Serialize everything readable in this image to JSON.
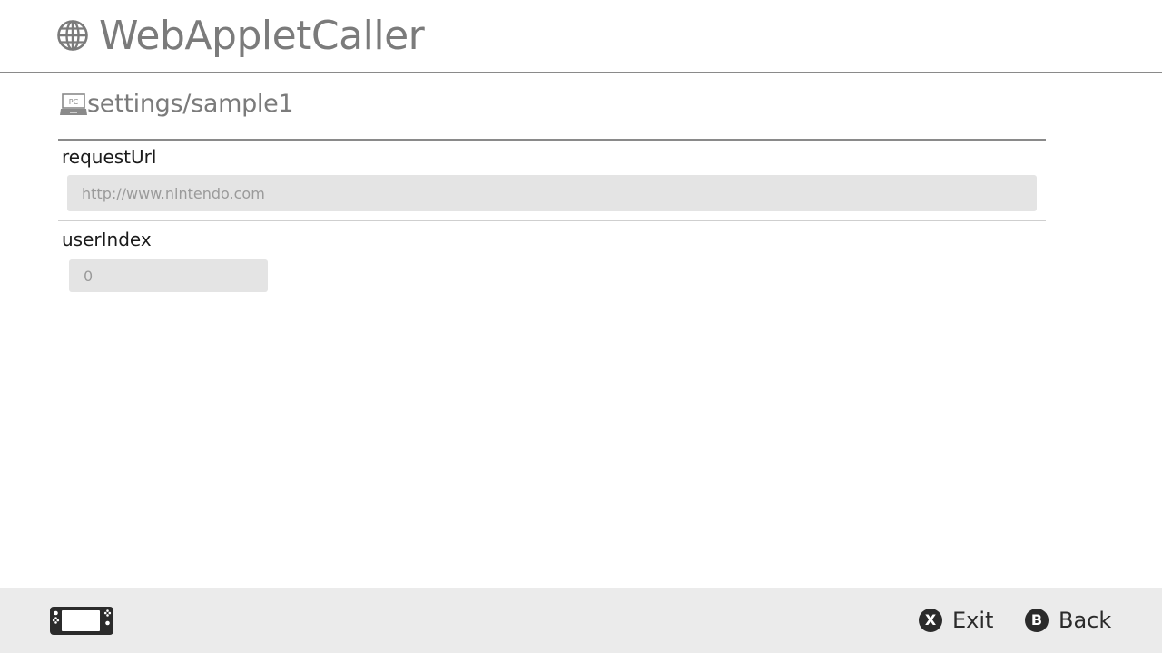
{
  "header": {
    "title": "WebAppletCaller",
    "icon": "globe-icon"
  },
  "section": {
    "title": "settings/sample1",
    "icon": "pc-icon",
    "icon_text": "PC"
  },
  "fields": [
    {
      "label": "requestUrl",
      "value": "",
      "placeholder": "http://www.nintendo.com"
    },
    {
      "label": "userIndex",
      "value": "",
      "placeholder": "0"
    }
  ],
  "footer": {
    "device_icon": "console-handheld-icon",
    "exit": {
      "glyph": "X",
      "label": "Exit"
    },
    "back": {
      "glyph": "B",
      "label": "Back"
    }
  },
  "colors": {
    "title_gray": "#7b7b7b",
    "input_bg": "#e4e4e4",
    "footer_bg": "#ebebeb",
    "button_dark": "#2b2b2b"
  }
}
